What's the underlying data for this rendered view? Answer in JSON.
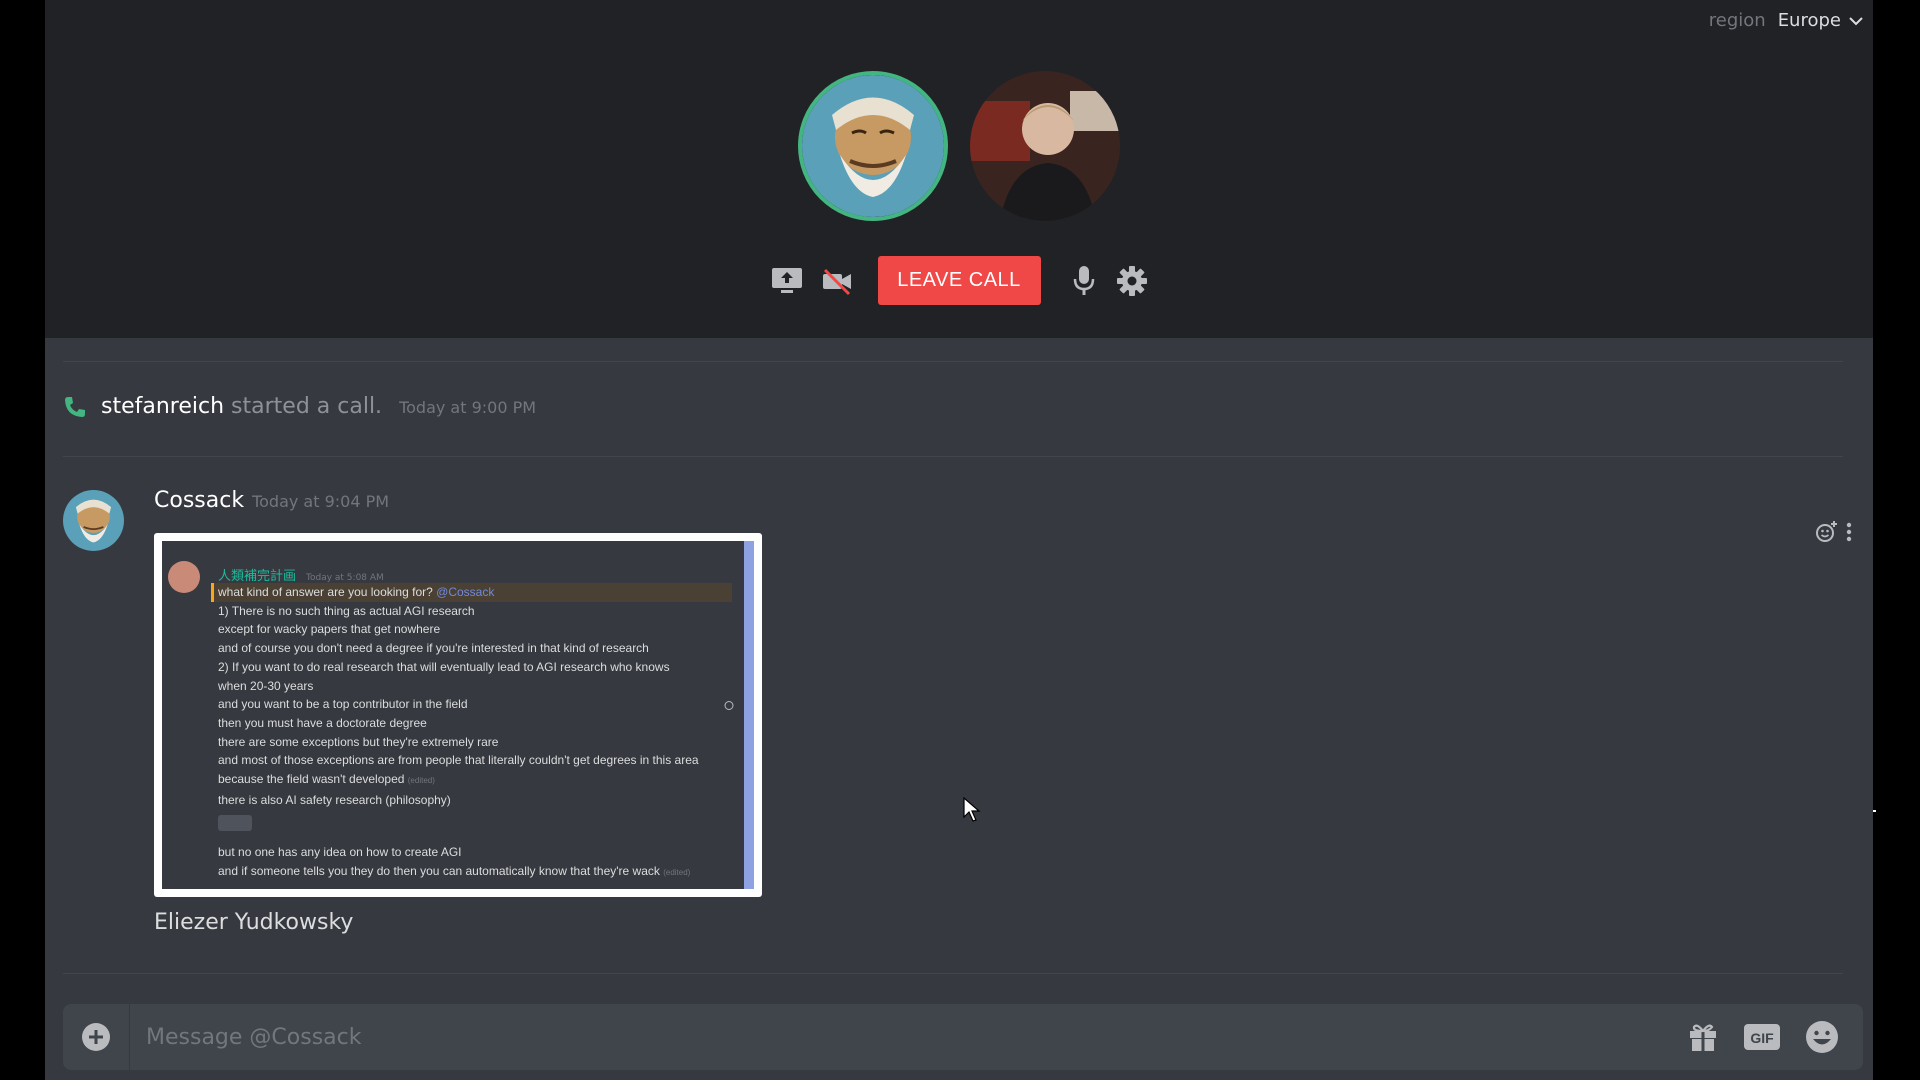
{
  "call": {
    "region_label": "region",
    "region_value": "Europe",
    "leave_label": "LEAVE CALL"
  },
  "system_message": {
    "user": "stefanreich",
    "text": "started a call.",
    "timestamp": "Today at 9:00 PM"
  },
  "message": {
    "author": "Cossack",
    "timestamp": "Today at 9:04 PM",
    "caption": "Eliezer Yudkowsky",
    "attachment": {
      "author": "人類補完計画",
      "timestamp": "Today at 5:08 AM",
      "highlight_text": "what kind of answer are you looking for?",
      "mention": "@Cossack",
      "lines": [
        "1) There is no such thing as actual AGI research",
        "except for wacky papers that get nowhere",
        "and of course you don't need a degree if you're interested in that kind of research",
        "2) If you want to do real research that will eventually lead to AGI research who knows",
        "when 20-30 years",
        "and you want to be a top contributor in the field",
        "then you must have a doctorate degree",
        "there are some exceptions but they're extremely rare",
        "and most of those exceptions are from people that literally couldn't get degrees in this area",
        "because the field wasn't developed",
        "there is also AI safety research (philosophy)"
      ],
      "edited_label": "(edited)",
      "lines_after": [
        "but no one has any idea on how to create AGI",
        "and if someone tells you they do then you can automatically know that they're wack"
      ]
    }
  },
  "composer": {
    "placeholder": "Message @Cossack"
  },
  "colors": {
    "accent": "#7289da",
    "danger": "#f04747",
    "speaking": "#43b581",
    "call_icon": "#43b581"
  }
}
